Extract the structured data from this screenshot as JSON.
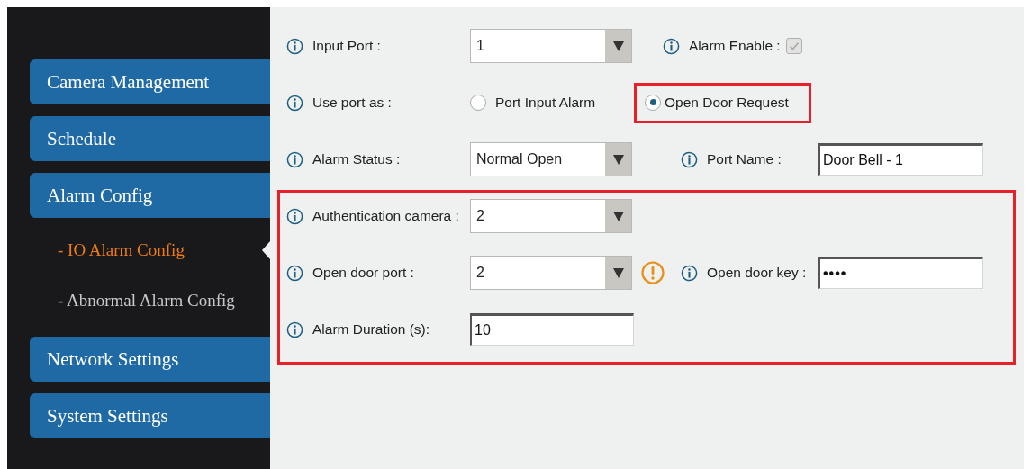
{
  "sidebar": {
    "items": [
      {
        "label": "Camera Management",
        "kind": "main",
        "selected": false
      },
      {
        "label": "Schedule",
        "kind": "main",
        "selected": false
      },
      {
        "label": "Alarm Config",
        "kind": "main",
        "selected": false
      },
      {
        "label": "- IO Alarm Config",
        "kind": "sub",
        "selected": true
      },
      {
        "label": "- Abnormal Alarm Config",
        "kind": "sub",
        "selected": false
      },
      {
        "label": "Network Settings",
        "kind": "main",
        "selected": false
      },
      {
        "label": "System Settings",
        "kind": "main",
        "selected": false
      }
    ]
  },
  "form": {
    "sections": [
      {
        "highlighted": false,
        "rows": [
          {
            "label": "Input Port :",
            "control": {
              "kind": "select",
              "value": "1"
            },
            "right": {
              "label": "Alarm Enable :",
              "control": {
                "kind": "checkbox",
                "checked": true,
                "disabled": true
              }
            }
          },
          {
            "label": "Use port as :",
            "control": {
              "kind": "radio",
              "options": [
                {
                  "label": "Port Input Alarm",
                  "selected": false,
                  "highlighted": false
                },
                {
                  "label": "Open Door Request",
                  "selected": true,
                  "highlighted": true
                }
              ]
            }
          },
          {
            "label": "Alarm Status :",
            "control": {
              "kind": "select",
              "value": "Normal Open"
            },
            "right": {
              "label": "Port Name :",
              "control": {
                "kind": "input",
                "value": "Door Bell - 1"
              }
            }
          }
        ]
      },
      {
        "highlighted": true,
        "rows": [
          {
            "label": "Authentication camera :",
            "control": {
              "kind": "select",
              "value": "2"
            }
          },
          {
            "label": "Open door port :",
            "control": {
              "kind": "select",
              "value": "2"
            },
            "warning": true,
            "right": {
              "label": "Open door key :",
              "control": {
                "kind": "password",
                "value": "••••"
              }
            }
          },
          {
            "label": "Alarm Duration (s):",
            "control": {
              "kind": "input",
              "value": "10"
            }
          }
        ]
      }
    ]
  }
}
